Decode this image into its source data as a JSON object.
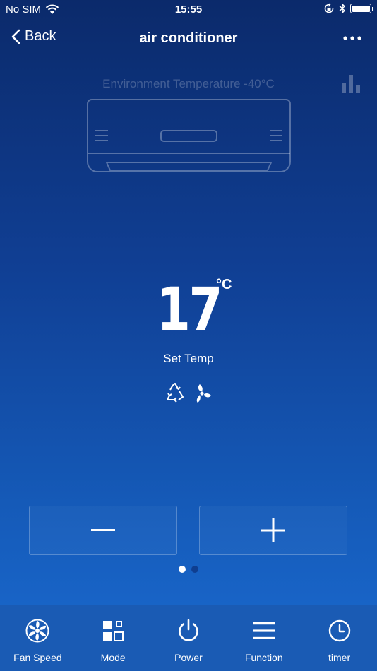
{
  "status": {
    "carrier": "No SIM",
    "time": "15:55"
  },
  "nav": {
    "back_label": "Back",
    "title": "air conditioner"
  },
  "environment": {
    "label": "Environment Temperature -40°C"
  },
  "temperature": {
    "value": "17",
    "unit": "°C",
    "label": "Set Temp"
  },
  "mode_icons": [
    "recycle-icon",
    "fan-icon"
  ],
  "controls": {
    "decrease": "minus-icon",
    "increase": "plus-icon"
  },
  "pager": {
    "pages": 2,
    "active": 0
  },
  "tabs": [
    {
      "label": "Fan Speed",
      "icon": "fan-speed-icon"
    },
    {
      "label": "Mode",
      "icon": "mode-icon"
    },
    {
      "label": "Power",
      "icon": "power-icon"
    },
    {
      "label": "Function",
      "icon": "menu-icon"
    },
    {
      "label": "timer",
      "icon": "clock-icon"
    }
  ],
  "colors": {
    "background_top": "#0b2a6b",
    "background_bottom": "#1a6ad0",
    "tab_bar": "#1a5bb4",
    "text": "#ffffff"
  }
}
